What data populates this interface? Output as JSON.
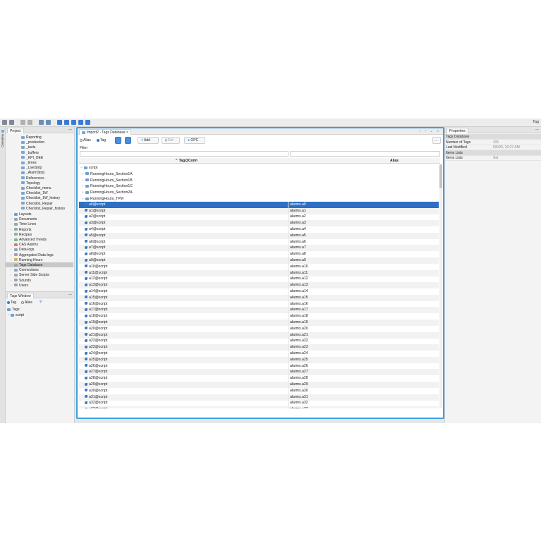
{
  "toolbar": {
    "right_label": "Tag"
  },
  "sidebar_tabs": {
    "overview": "Overview"
  },
  "project": {
    "tab": "Project",
    "items": [
      {
        "label": "Reporting",
        "kind": "screen",
        "level": 3
      },
      {
        "label": "_production",
        "kind": "screen",
        "level": 3
      },
      {
        "label": "_tacts",
        "kind": "screen",
        "level": 3
      },
      {
        "label": "_buffers",
        "kind": "screen",
        "level": 3
      },
      {
        "label": "_KPI_OEE",
        "kind": "screen",
        "level": 3
      },
      {
        "label": "_times",
        "kind": "screen",
        "level": 3
      },
      {
        "label": "_LiveStrip",
        "kind": "screen",
        "level": 3
      },
      {
        "label": "_AlarmStrip",
        "kind": "screen",
        "level": 3
      },
      {
        "label": "References",
        "kind": "screen",
        "level": 3
      },
      {
        "label": "Topology",
        "kind": "screen",
        "level": 3
      },
      {
        "label": "Checklist_menu",
        "kind": "screen",
        "level": 3
      },
      {
        "label": "Checklist_1W",
        "kind": "screen",
        "level": 3
      },
      {
        "label": "Checklist_1W_history",
        "kind": "screen",
        "level": 3
      },
      {
        "label": "Checklist_Repair",
        "kind": "screen",
        "level": 3
      },
      {
        "label": "Checklist_Repair_history",
        "kind": "screen",
        "level": 3
      },
      {
        "label": "Layouts",
        "kind": "folder",
        "level": 1
      },
      {
        "label": "Documents",
        "kind": "doc",
        "level": 1
      },
      {
        "label": "Time Lines",
        "kind": "doc",
        "level": 1
      },
      {
        "label": "Reports",
        "kind": "doc",
        "level": 1
      },
      {
        "label": "Recipes",
        "kind": "doc",
        "level": 1
      },
      {
        "label": "Advanced Trends",
        "kind": "green",
        "level": 1
      },
      {
        "label": "CAS Alarms",
        "kind": "red",
        "level": 1
      },
      {
        "label": "Data-logs",
        "kind": "doc",
        "level": 1
      },
      {
        "label": "Aggregated Data-logs",
        "kind": "doc",
        "level": 1
      },
      {
        "label": "Running Hours",
        "kind": "gold",
        "level": 1
      },
      {
        "label": "Tags Database",
        "kind": "doc",
        "level": 1,
        "selected": true
      },
      {
        "label": "Connections",
        "kind": "doc",
        "level": 1
      },
      {
        "label": "Server Side Scripts",
        "kind": "doc",
        "level": 1
      },
      {
        "label": "Sounds",
        "kind": "doc",
        "level": 1
      },
      {
        "label": "Users",
        "kind": "doc",
        "level": 1
      }
    ]
  },
  "tags_window": {
    "tab": "Tags Window",
    "radio_tag": "Tag",
    "radio_alias": "Alias",
    "root_label": "Tags:",
    "child_label": "script"
  },
  "editor": {
    "tab": "Import2 - Tags Database",
    "toolbar": {
      "alias": "Alias",
      "tag": "Tag",
      "add": "Add",
      "del": "Del",
      "opc": "OPC",
      "more": "..."
    },
    "filter_label": "Filter",
    "columns": {
      "tag": "Tag@Conn",
      "alias": "Alias"
    },
    "tree_root": "script",
    "folders": [
      "RunningHours_Section1A",
      "RunningHours_Section1B",
      "RunningHours_Section1C",
      "RunningHours_Section2A",
      "RunningHours_TPM"
    ],
    "rows": [
      {
        "tag": "a0@script",
        "alias": "alarms.a0"
      },
      {
        "tag": "a1@script",
        "alias": "alarms.a1"
      },
      {
        "tag": "a2@script",
        "alias": "alarms.a2"
      },
      {
        "tag": "a3@script",
        "alias": "alarms.a3"
      },
      {
        "tag": "a4@script",
        "alias": "alarms.a4"
      },
      {
        "tag": "a5@script",
        "alias": "alarms.a5"
      },
      {
        "tag": "a6@script",
        "alias": "alarms.a6"
      },
      {
        "tag": "a7@script",
        "alias": "alarms.a7"
      },
      {
        "tag": "a8@script",
        "alias": "alarms.a8"
      },
      {
        "tag": "a9@script",
        "alias": "alarms.a9"
      },
      {
        "tag": "a10@script",
        "alias": "alarms.a10"
      },
      {
        "tag": "a11@script",
        "alias": "alarms.a11"
      },
      {
        "tag": "a12@script",
        "alias": "alarms.a12"
      },
      {
        "tag": "a13@script",
        "alias": "alarms.a13"
      },
      {
        "tag": "a14@script",
        "alias": "alarms.a14"
      },
      {
        "tag": "a15@script",
        "alias": "alarms.a15"
      },
      {
        "tag": "a16@script",
        "alias": "alarms.a16"
      },
      {
        "tag": "a17@script",
        "alias": "alarms.a17"
      },
      {
        "tag": "a18@script",
        "alias": "alarms.a18"
      },
      {
        "tag": "a19@script",
        "alias": "alarms.a19"
      },
      {
        "tag": "a20@script",
        "alias": "alarms.a20"
      },
      {
        "tag": "a21@script",
        "alias": "alarms.a21"
      },
      {
        "tag": "a22@script",
        "alias": "alarms.a22"
      },
      {
        "tag": "a23@script",
        "alias": "alarms.a23"
      },
      {
        "tag": "a24@script",
        "alias": "alarms.a24"
      },
      {
        "tag": "a25@script",
        "alias": "alarms.a25"
      },
      {
        "tag": "a26@script",
        "alias": "alarms.a26"
      },
      {
        "tag": "a27@script",
        "alias": "alarms.a27"
      },
      {
        "tag": "a28@script",
        "alias": "alarms.a28"
      },
      {
        "tag": "a29@script",
        "alias": "alarms.a29"
      },
      {
        "tag": "a30@script",
        "alias": "alarms.a30"
      },
      {
        "tag": "a31@script",
        "alias": "alarms.a31"
      },
      {
        "tag": "a32@script",
        "alias": "alarms.a32"
      },
      {
        "tag": "a33@script",
        "alias": "alarms.a33"
      }
    ],
    "selected_row": 0
  },
  "properties": {
    "tab": "Properties",
    "rows": [
      {
        "key": "Tags Database",
        "section": true
      },
      {
        "key": "Number of Tags",
        "value": "431"
      },
      {
        "key": "Last Modified",
        "value": "6/6/20, 10:27 AM"
      },
      {
        "key": "Items Lists",
        "section": true
      },
      {
        "key": "Items Lists",
        "value": "Set"
      }
    ]
  },
  "colors": {
    "accent": "#3ba0e3",
    "selection": "#2d6fc4"
  }
}
